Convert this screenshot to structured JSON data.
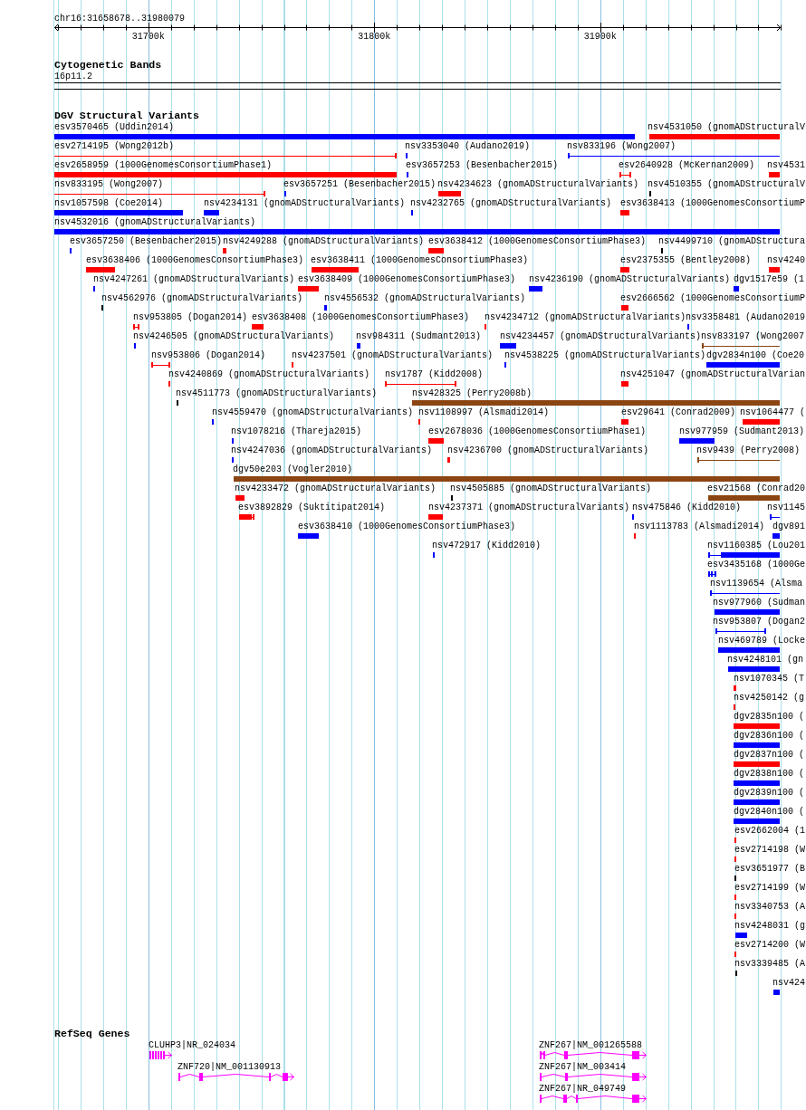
{
  "ruler": {
    "location": "chr16:31658678..31980079",
    "ticks": [
      "31700k",
      "31800k",
      "31900k"
    ]
  },
  "tracks": [
    {
      "kind": "cytoband",
      "title": "Cytogenetic Bands",
      "features": [
        {
          "label": "16p11.2"
        }
      ]
    },
    {
      "kind": "variants",
      "title": "DGV Structural Variants",
      "features": [
        {
          "label": "esv3570465 (Uddin2014)",
          "color": "#0000ff",
          "kind": "bar"
        },
        {
          "label": "nsv4531050 (gnomADStructuralV",
          "color": "#ff0000",
          "kind": "bar"
        },
        {
          "label": "esv2714195 (Wong2012b)",
          "color": "#ff0000",
          "kind": "span"
        },
        {
          "label": "nsv3353040 (Audano2019)",
          "color": "#0000ff",
          "kind": "bar"
        },
        {
          "label": "nsv833196 (Wong2007)",
          "color": "#0000ff",
          "kind": "span"
        },
        {
          "label": "esv2658959 (1000GenomesConsortiumPhase1)",
          "color": "#ff0000",
          "kind": "bar"
        },
        {
          "label": "esv3657253 (Besenbacher2015)",
          "color": "#0000ff",
          "kind": "bar"
        },
        {
          "label": "esv2640928 (McKernan2009)",
          "color": "#ff0000",
          "kind": "span"
        },
        {
          "label": "nsv4531",
          "color": "#ff0000",
          "kind": "bar"
        },
        {
          "label": "nsv833195 (Wong2007)",
          "color": "#ff0000",
          "kind": "span"
        },
        {
          "label": "esv3657251 (Besenbacher2015)",
          "color": "#0000ff",
          "kind": "bar"
        },
        {
          "label": "nsv4234623 (gnomADStructuralVariants)",
          "color": "#ff0000",
          "kind": "bar"
        },
        {
          "label": "nsv4510355 (gnomADStructuralV",
          "color": "#000000",
          "kind": "bar"
        },
        {
          "label": "nsv1057598 (Coe2014)",
          "color": "#0000ff",
          "kind": "bar"
        },
        {
          "label": "nsv4234131 (gnomADStructuralVariants)",
          "color": "#0000ff",
          "kind": "bar"
        },
        {
          "label": "nsv4232765 (gnomADStructuralVariants)",
          "color": "#0000ff",
          "kind": "bar"
        },
        {
          "label": "esv3638413 (1000GenomesConsortiumP",
          "color": "#ff0000",
          "kind": "bar"
        },
        {
          "label": "nsv4532016 (gnomADStructuralVariants)",
          "color": "#0000ff",
          "kind": "bar"
        },
        {
          "label": "esv3657250 (Besenbacher2015)",
          "color": "#0000ff",
          "kind": "bar"
        },
        {
          "label": "nsv4249288 (gnomADStructuralVariants)",
          "color": "#ff0000",
          "kind": "bar"
        },
        {
          "label": "esv3638412 (1000GenomesConsortiumPhase3)",
          "color": "#ff0000",
          "kind": "bar"
        },
        {
          "label": "nsv4499710 (gnomADStructura",
          "color": "#000000",
          "kind": "bar"
        },
        {
          "label": "esv3638406 (1000GenomesConsortiumPhase3)",
          "color": "#ff0000",
          "kind": "bar"
        },
        {
          "label": "esv3638411 (1000GenomesConsortiumPhase3)",
          "color": "#ff0000",
          "kind": "bar"
        },
        {
          "label": "esv2375355 (Bentley2008)",
          "color": "#ff0000",
          "kind": "bar"
        },
        {
          "label": "nsv4240",
          "color": "#ff0000",
          "kind": "bar"
        },
        {
          "label": "nsv4247261 (gnomADStructuralVariants)",
          "color": "#0000ff",
          "kind": "bar"
        },
        {
          "label": "esv3638409 (1000GenomesConsortiumPhase3)",
          "color": "#ff0000",
          "kind": "bar"
        },
        {
          "label": "nsv4236190 (gnomADStructuralVariants)",
          "color": "#0000ff",
          "kind": "bar"
        },
        {
          "label": "dgv1517e59 (1",
          "color": "#0000ff",
          "kind": "bar"
        },
        {
          "label": "nsv4562976 (gnomADStructuralVariants)",
          "color": "#000000",
          "kind": "bar"
        },
        {
          "label": "nsv4556532 (gnomADStructuralVariants)",
          "color": "#0000ff",
          "kind": "bar"
        },
        {
          "label": "esv2666562 (1000GenomesConsortiumP",
          "color": "#ff0000",
          "kind": "bar"
        },
        {
          "label": "nsv953805 (Dogan2014)",
          "color": "#ff0000",
          "kind": "span"
        },
        {
          "label": "esv3638408 (1000GenomesConsortiumPhase3)",
          "color": "#ff0000",
          "kind": "bar"
        },
        {
          "label": "nsv4234712 (gnomADStructuralVariants)",
          "color": "#ff0000",
          "kind": "bar"
        },
        {
          "label": "nsv3358481 (Audano2019",
          "color": "#0000ff",
          "kind": "bar"
        },
        {
          "label": "nsv4246505 (gnomADStructuralVariants)",
          "color": "#0000ff",
          "kind": "bar"
        },
        {
          "label": "nsv984311 (Sudmant2013)",
          "color": "#0000ff",
          "kind": "bar"
        },
        {
          "label": "nsv4234457 (gnomADStructuralVariants)",
          "color": "#0000ff",
          "kind": "bar"
        },
        {
          "label": "nsv833197 (Wong2007",
          "color": "#8b4513",
          "kind": "span"
        },
        {
          "label": "nsv953806 (Dogan2014)",
          "color": "#ff0000",
          "kind": "span"
        },
        {
          "label": "nsv4237501 (gnomADStructuralVariants)",
          "color": "#ff0000",
          "kind": "bar"
        },
        {
          "label": "nsv4538225 (gnomADStructuralVariants)",
          "color": "#0000ff",
          "kind": "bar"
        },
        {
          "label": "dgv2834n100 (Coe20",
          "color": "#0000ff",
          "kind": "bar"
        },
        {
          "label": "nsv4240869 (gnomADStructuralVariants)",
          "color": "#ff0000",
          "kind": "bar"
        },
        {
          "label": "nsv1787 (Kidd2008)",
          "color": "#ff0000",
          "kind": "span"
        },
        {
          "label": "nsv4251047 (gnomADStructuralVarian",
          "color": "#ff0000",
          "kind": "bar"
        },
        {
          "label": "nsv4511773 (gnomADStructuralVariants)",
          "color": "#000000",
          "kind": "bar"
        },
        {
          "label": "nsv428325 (Perry2008b)",
          "color": "#8b4513",
          "kind": "bar"
        },
        {
          "label": "nsv4559470 (gnomADStructuralVariants)",
          "color": "#0000ff",
          "kind": "bar"
        },
        {
          "label": "nsv1108997 (Alsmadi2014)",
          "color": "#ff0000",
          "kind": "bar"
        },
        {
          "label": "esv29641 (Conrad2009)",
          "color": "#ff0000",
          "kind": "bar"
        },
        {
          "label": "nsv1064477 (",
          "color": "#ff0000",
          "kind": "bar"
        },
        {
          "label": "nsv1078216 (Thareja2015)",
          "color": "#0000ff",
          "kind": "bar"
        },
        {
          "label": "esv2678036 (1000GenomesConsortiumPhase1)",
          "color": "#ff0000",
          "kind": "bar"
        },
        {
          "label": "nsv977959 (Sudmant2013)",
          "color": "#0000ff",
          "kind": "bar"
        },
        {
          "label": "nsv4247036 (gnomADStructuralVariants)",
          "color": "#0000ff",
          "kind": "bar"
        },
        {
          "label": "nsv4236700 (gnomADStructuralVariants)",
          "color": "#ff0000",
          "kind": "bar"
        },
        {
          "label": "nsv9439 (Perry2008)",
          "color": "#8b4513",
          "kind": "span"
        },
        {
          "label": "dgv50e203 (Vogler2010)",
          "color": "#8b4513",
          "kind": "bar"
        },
        {
          "label": "nsv4233472 (gnomADStructuralVariants)",
          "color": "#ff0000",
          "kind": "bar"
        },
        {
          "label": "nsv4505885 (gnomADStructuralVariants)",
          "color": "#000000",
          "kind": "bar"
        },
        {
          "label": "esv21568 (Conrad20",
          "color": "#8b4513",
          "kind": "bar"
        },
        {
          "label": "esv3892829 (Suktitipat2014)",
          "color": "#ff0000",
          "kind": "span"
        },
        {
          "label": "nsv4237371 (gnomADStructuralVariants)",
          "color": "#ff0000",
          "kind": "bar"
        },
        {
          "label": "nsv475846 (Kidd2010)",
          "color": "#0000ff",
          "kind": "bar"
        },
        {
          "label": "nsv1145",
          "color": "#0000ff",
          "kind": "span"
        },
        {
          "label": "esv3638410 (1000GenomesConsortiumPhase3)",
          "color": "#0000ff",
          "kind": "bar"
        },
        {
          "label": "nsv1113783 (Alsmadi2014)",
          "color": "#ff0000",
          "kind": "bar"
        },
        {
          "label": "dgv891",
          "color": "#0000ff",
          "kind": "bar"
        },
        {
          "label": "nsv472917 (Kidd2010)",
          "color": "#0000ff",
          "kind": "bar"
        },
        {
          "label": "nsv1160385 (Lou201",
          "color": "#0000ff",
          "kind": "span"
        },
        {
          "label": "esv3435168 (1000Ge",
          "color": "#0000ff",
          "kind": "span"
        },
        {
          "label": "nsv1139654 (Alsma",
          "color": "#0000ff",
          "kind": "span"
        },
        {
          "label": "nsv977960 (Sudman",
          "color": "#0000ff",
          "kind": "bar"
        },
        {
          "label": "nsv953807 (Dogan2",
          "color": "#0000ff",
          "kind": "span"
        },
        {
          "label": "nsv469789 (Locke",
          "color": "#0000ff",
          "kind": "bar"
        },
        {
          "label": "nsv4248101 (gn",
          "color": "#0000ff",
          "kind": "bar"
        },
        {
          "label": "nsv1070345 (T",
          "color": "#ff0000",
          "kind": "bar"
        },
        {
          "label": "nsv4250142 (g",
          "color": "#ff0000",
          "kind": "bar"
        },
        {
          "label": "dgv2835n100 (",
          "color": "#ff0000",
          "kind": "bar"
        },
        {
          "label": "dgv2836n100 (",
          "color": "#0000ff",
          "kind": "bar"
        },
        {
          "label": "dgv2837n100 (",
          "color": "#ff0000",
          "kind": "bar"
        },
        {
          "label": "dgv2838n100 (",
          "color": "#0000ff",
          "kind": "bar"
        },
        {
          "label": "dgv2839n100 (",
          "color": "#0000ff",
          "kind": "bar"
        },
        {
          "label": "dgv2840n100 (",
          "color": "#0000ff",
          "kind": "bar"
        },
        {
          "label": "esv2662004 (1",
          "color": "#ff0000",
          "kind": "bar"
        },
        {
          "label": "esv2714198 (W",
          "color": "#ff0000",
          "kind": "bar"
        },
        {
          "label": "esv3651977 (B",
          "color": "#000000",
          "kind": "bar"
        },
        {
          "label": "esv2714199 (W",
          "color": "#ff0000",
          "kind": "bar"
        },
        {
          "label": "nsv3340753 (A",
          "color": "#ff0000",
          "kind": "bar"
        },
        {
          "label": "nsv4248031 (g",
          "color": "#0000ff",
          "kind": "bar"
        },
        {
          "label": "esv2714200 (W",
          "color": "#ff0000",
          "kind": "bar"
        },
        {
          "label": "nsv3339485 (A",
          "color": "#000000",
          "kind": "bar"
        },
        {
          "label": "nsv424",
          "color": "#0000ff",
          "kind": "bar"
        }
      ]
    },
    {
      "kind": "genes",
      "title": "RefSeq Genes",
      "features": [
        {
          "label": "CLUHP3|NR_024034",
          "forward": true
        },
        {
          "label": "ZNF720|NM_001130913",
          "forward": true
        },
        {
          "label": "ZNF267|NM_001265588",
          "forward": true
        },
        {
          "label": "ZNF267|NM_003414",
          "forward": true
        },
        {
          "label": "ZNF267|NR_049749",
          "forward": true
        }
      ]
    }
  ]
}
